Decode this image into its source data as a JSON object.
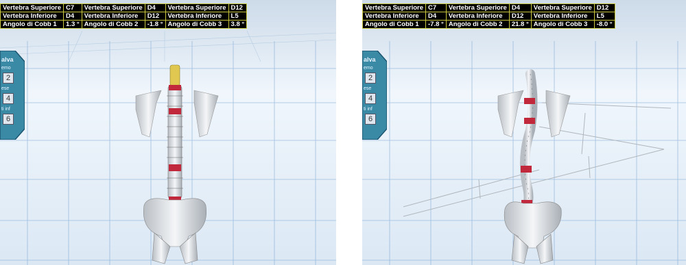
{
  "panels": [
    {
      "table": [
        [
          "Vertebra Superiore",
          "C7",
          "Vertebra Superiore",
          "D4",
          "Vertebra Superiore",
          "D12"
        ],
        [
          "Vertebra Inferiore",
          "D4",
          "Vertebra Inferiore",
          "D12",
          "Vertebra Inferiore",
          "L5"
        ],
        [
          "Angolo di Cobb 1",
          "1.3 °",
          "Angolo di Cobb 2",
          "-1.8 °",
          "Angolo di Cobb 3",
          "3.8 °"
        ]
      ],
      "side": {
        "title": "alva",
        "l1": "emo",
        "n1": "2",
        "l2": "ese",
        "n2": "4",
        "l3": "ti inf",
        "n3": "6"
      }
    },
    {
      "table": [
        [
          "Vertebra Superiore",
          "C7",
          "Vertebra Superiore",
          "D4",
          "Vertebra Superiore",
          "D12"
        ],
        [
          "Vertebra Inferiore",
          "D4",
          "Vertebra Inferiore",
          "D12",
          "Vertebra Inferiore",
          "L5"
        ],
        [
          "Angolo di Cobb 1",
          "-7.8 °",
          "Angolo di Cobb 2",
          "21.8 °",
          "Angolo di Cobb 3",
          "-8.0 °"
        ]
      ],
      "side": {
        "title": "alva",
        "l1": "emo",
        "n1": "2",
        "l2": "ese",
        "n2": "4",
        "l3": "ti inf",
        "n3": "6"
      }
    }
  ],
  "colors": {
    "table_bg": "#000000",
    "table_border": "#c8c83a",
    "table_text": "#ffffff",
    "side_panel": "#3a8aa6",
    "scene_bg": "#e3eef8",
    "grid": "#7fa8d4",
    "bone": "#e2e5e8",
    "highlight_red": "#c2283c",
    "highlight_yellow": "#e0c850"
  }
}
